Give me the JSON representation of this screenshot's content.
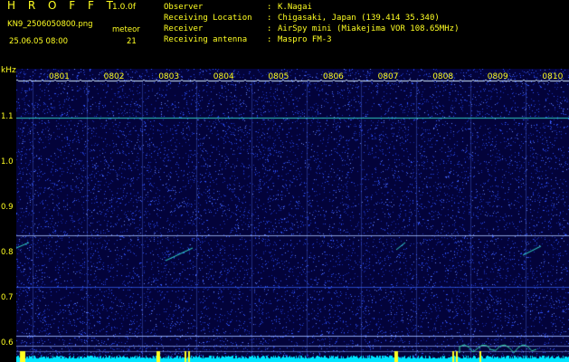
{
  "header": {
    "app_title": "H R O F F T",
    "version": "1.0.0f",
    "filename": "KN9_2506050800.png",
    "datetime": "25.06.05 08:00",
    "meteor_label": "meteor",
    "meteor_count": "21"
  },
  "info": [
    {
      "label": "Observer",
      "value": "K.Nagai"
    },
    {
      "label": "Receiving Location",
      "value": "Chigasaki, Japan (139.414 35.340)"
    },
    {
      "label": "Receiver",
      "value": "AirSpy mini (Miakejima VOR 108.65MHz)"
    },
    {
      "label": "Receiving antenna",
      "value": "Maspro FM-3"
    }
  ],
  "axis": {
    "unit": "kHz",
    "ticks": [
      {
        "label": "1.1",
        "v": 1.1
      },
      {
        "label": "1.0",
        "v": 1.0
      },
      {
        "label": "0.9",
        "v": 0.9
      },
      {
        "label": "0.8",
        "v": 0.8
      },
      {
        "label": "0.7",
        "v": 0.7
      },
      {
        "label": "0.6",
        "v": 0.6
      }
    ]
  },
  "time_labels": [
    "0801",
    "0802",
    "0803",
    "0804",
    "0805",
    "0806",
    "0807",
    "0808",
    "0809",
    "0810"
  ],
  "colors": {
    "text": "#ffff22",
    "background": "#03033a",
    "noise": "#2a4cff",
    "trace": "#33ddcc",
    "baseline": "#00e5ff"
  }
}
